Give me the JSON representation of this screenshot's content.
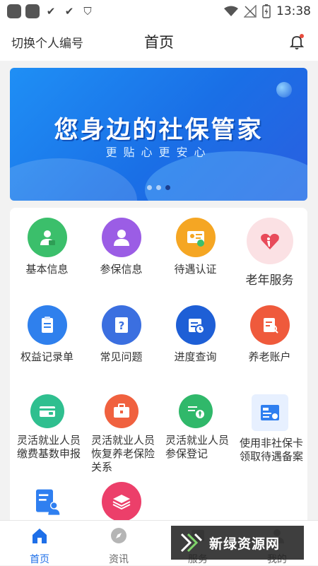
{
  "status_bar": {
    "time": "13:38"
  },
  "header": {
    "switch_label": "切换个人编号",
    "title": "首页"
  },
  "banner": {
    "title": "您身边的社保管家",
    "subtitle": "更贴心更安心",
    "slide_count": 3,
    "active_slide": 3
  },
  "grid": {
    "items": [
      {
        "label": "基本信息",
        "icon": "id-card-person-icon",
        "color": "#3bbf6b"
      },
      {
        "label": "参保信息",
        "icon": "person-icon",
        "color": "#9b5de5"
      },
      {
        "label": "待遇认证",
        "icon": "certificate-icon",
        "color": "#f5a623"
      },
      {
        "label": "老年服务",
        "icon": "elderly-heart-icon",
        "color": "#e84b5a"
      },
      {
        "label": "权益记录单",
        "icon": "clipboard-icon",
        "color": "#2f80ed"
      },
      {
        "label": "常见问题",
        "icon": "question-doc-icon",
        "color": "#3b6fe0"
      },
      {
        "label": "进度查询",
        "icon": "schedule-icon",
        "color": "#1e5fd6"
      },
      {
        "label": "养老账户",
        "icon": "document-search-icon",
        "color": "#ef5a3c"
      },
      {
        "label": "灵活就业人员缴费基数申报",
        "icon": "wallet-card-icon",
        "color": "#2fbf8f"
      },
      {
        "label": "灵活就业人员恢复养老保险关系",
        "icon": "briefcase-icon",
        "color": "#f0613f"
      },
      {
        "label": "灵活就业人员参保登记",
        "icon": "tie-register-icon",
        "color": "#30b86a"
      },
      {
        "label": "使用非社保卡领取待遇备案",
        "icon": "card-apply-icon",
        "color": "#2f7ff0"
      },
      {
        "label": "",
        "icon": "doc-person-icon",
        "color": "#2f7ff0"
      },
      {
        "label": "",
        "icon": "layers-icon",
        "color": "#ec3f6a"
      }
    ]
  },
  "bottom_nav": [
    {
      "label": "首页",
      "icon": "home-icon",
      "active": true
    },
    {
      "label": "资讯",
      "icon": "compass-icon",
      "active": false
    },
    {
      "label": "服务",
      "icon": "service-icon",
      "active": false
    },
    {
      "label": "我的",
      "icon": "user-icon",
      "active": false
    }
  ],
  "watermark": {
    "text": "新绿资源网"
  }
}
